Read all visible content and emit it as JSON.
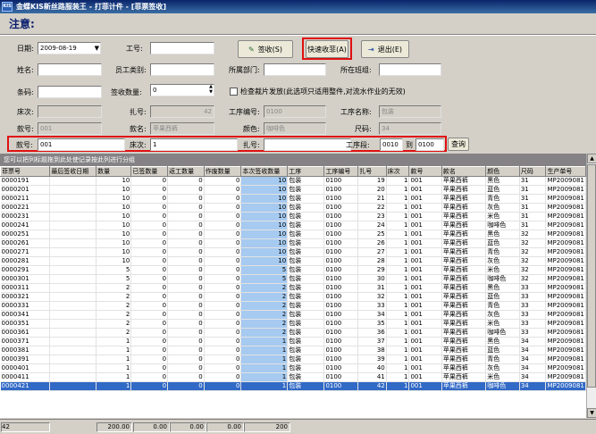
{
  "window": {
    "title": "金蝶KIS新丝路服装王 - 打菲计件 - [菲票签收]",
    "icon_text": "KIS"
  },
  "notice_title": "注意:",
  "form": {
    "date_label": "日期:",
    "date_value": "2009-08-19",
    "worker_no_label": "工号:",
    "name_label": "姓名:",
    "emp_type_label": "员工类别:",
    "dept_label": "所属部门:",
    "group_label": "所在班组:",
    "barcode_label": "条码:",
    "qty_label": "签收数量:",
    "qty_value": "0",
    "check_label": "检查裁片发放(此选项只适用整件,对流水作业的无效)",
    "bed_label": "床次:",
    "tie_label": "扎号:",
    "tie_value": "42",
    "proc_no_label": "工序编号:",
    "proc_no_value": "0100",
    "proc_name_label": "工序名称:",
    "proc_name_value": "包装",
    "style_label": "款号:",
    "style_value": "001",
    "style_name_label": "款名:",
    "style_name_value": "苹果西裤",
    "color_label": "颜色:",
    "color_value": "咖啡色",
    "size_label": "尺码:",
    "size_value": "34"
  },
  "buttons": {
    "sign": "签收(S)",
    "quick": "快速收菲(A)",
    "exit": "退出(E)",
    "query": "查询"
  },
  "filter": {
    "style_label": "款号:",
    "style_value": "001",
    "bed_label": "床次:",
    "bed_value": "1",
    "tie_label": "扎号:",
    "proc_label": "工序段:",
    "from": "0010",
    "to_label": "到",
    "to": "0100"
  },
  "group_hint": "您可以把列标题拖到此处使记录按此列进行分组",
  "table": {
    "columns": [
      "菲票号",
      "最后签收日期",
      "数量",
      "已签数量",
      "返工数量",
      "作废数量",
      "本次签收数量",
      "工序",
      "工序编号",
      "扎号",
      "床次",
      "款号",
      "款名",
      "颜色",
      "尺码",
      "生产单号"
    ],
    "rows": [
      [
        "0000191",
        "",
        "10",
        "0",
        "0",
        "0",
        "10",
        "包装",
        "0100",
        "19",
        "1",
        "001",
        "苹果西裤",
        "黑色",
        "31",
        "MP2009081"
      ],
      [
        "0000201",
        "",
        "10",
        "0",
        "0",
        "0",
        "10",
        "包装",
        "0100",
        "20",
        "1",
        "001",
        "苹果西裤",
        "蓝色",
        "31",
        "MP2009081"
      ],
      [
        "0000211",
        "",
        "10",
        "0",
        "0",
        "0",
        "10",
        "包装",
        "0100",
        "21",
        "1",
        "001",
        "苹果西裤",
        "青色",
        "31",
        "MP2009081"
      ],
      [
        "0000221",
        "",
        "10",
        "0",
        "0",
        "0",
        "10",
        "包装",
        "0100",
        "22",
        "1",
        "001",
        "苹果西裤",
        "灰色",
        "31",
        "MP2009081"
      ],
      [
        "0000231",
        "",
        "10",
        "0",
        "0",
        "0",
        "10",
        "包装",
        "0100",
        "23",
        "1",
        "001",
        "苹果西裤",
        "米色",
        "31",
        "MP2009081"
      ],
      [
        "0000241",
        "",
        "10",
        "0",
        "0",
        "0",
        "10",
        "包装",
        "0100",
        "24",
        "1",
        "001",
        "苹果西裤",
        "咖啡色",
        "31",
        "MP2009081"
      ],
      [
        "0000251",
        "",
        "10",
        "0",
        "0",
        "0",
        "10",
        "包装",
        "0100",
        "25",
        "1",
        "001",
        "苹果西裤",
        "黑色",
        "32",
        "MP2009081"
      ],
      [
        "0000261",
        "",
        "10",
        "0",
        "0",
        "0",
        "10",
        "包装",
        "0100",
        "26",
        "1",
        "001",
        "苹果西裤",
        "蓝色",
        "32",
        "MP2009081"
      ],
      [
        "0000271",
        "",
        "10",
        "0",
        "0",
        "0",
        "10",
        "包装",
        "0100",
        "27",
        "1",
        "001",
        "苹果西裤",
        "青色",
        "32",
        "MP2009081"
      ],
      [
        "0000281",
        "",
        "10",
        "0",
        "0",
        "0",
        "10",
        "包装",
        "0100",
        "28",
        "1",
        "001",
        "苹果西裤",
        "灰色",
        "32",
        "MP2009081"
      ],
      [
        "0000291",
        "",
        "5",
        "0",
        "0",
        "0",
        "5",
        "包装",
        "0100",
        "29",
        "1",
        "001",
        "苹果西裤",
        "米色",
        "32",
        "MP2009081"
      ],
      [
        "0000301",
        "",
        "5",
        "0",
        "0",
        "0",
        "5",
        "包装",
        "0100",
        "30",
        "1",
        "001",
        "苹果西裤",
        "咖啡色",
        "32",
        "MP2009081"
      ],
      [
        "0000311",
        "",
        "2",
        "0",
        "0",
        "0",
        "2",
        "包装",
        "0100",
        "31",
        "1",
        "001",
        "苹果西裤",
        "黑色",
        "33",
        "MP2009081"
      ],
      [
        "0000321",
        "",
        "2",
        "0",
        "0",
        "0",
        "2",
        "包装",
        "0100",
        "32",
        "1",
        "001",
        "苹果西裤",
        "蓝色",
        "33",
        "MP2009081"
      ],
      [
        "0000331",
        "",
        "2",
        "0",
        "0",
        "0",
        "2",
        "包装",
        "0100",
        "33",
        "1",
        "001",
        "苹果西裤",
        "青色",
        "33",
        "MP2009081"
      ],
      [
        "0000341",
        "",
        "2",
        "0",
        "0",
        "0",
        "2",
        "包装",
        "0100",
        "34",
        "1",
        "001",
        "苹果西裤",
        "灰色",
        "33",
        "MP2009081"
      ],
      [
        "0000351",
        "",
        "2",
        "0",
        "0",
        "0",
        "2",
        "包装",
        "0100",
        "35",
        "1",
        "001",
        "苹果西裤",
        "米色",
        "33",
        "MP2009081"
      ],
      [
        "0000361",
        "",
        "2",
        "0",
        "0",
        "0",
        "2",
        "包装",
        "0100",
        "36",
        "1",
        "001",
        "苹果西裤",
        "咖啡色",
        "33",
        "MP2009081"
      ],
      [
        "0000371",
        "",
        "1",
        "0",
        "0",
        "0",
        "1",
        "包装",
        "0100",
        "37",
        "1",
        "001",
        "苹果西裤",
        "黑色",
        "34",
        "MP2009081"
      ],
      [
        "0000381",
        "",
        "1",
        "0",
        "0",
        "0",
        "1",
        "包装",
        "0100",
        "38",
        "1",
        "001",
        "苹果西裤",
        "蓝色",
        "34",
        "MP2009081"
      ],
      [
        "0000391",
        "",
        "1",
        "0",
        "0",
        "0",
        "1",
        "包装",
        "0100",
        "39",
        "1",
        "001",
        "苹果西裤",
        "青色",
        "34",
        "MP2009081"
      ],
      [
        "0000401",
        "",
        "1",
        "0",
        "0",
        "0",
        "1",
        "包装",
        "0100",
        "40",
        "1",
        "001",
        "苹果西裤",
        "灰色",
        "34",
        "MP2009081"
      ],
      [
        "0000411",
        "",
        "1",
        "0",
        "0",
        "0",
        "1",
        "包装",
        "0100",
        "41",
        "1",
        "001",
        "苹果西裤",
        "米色",
        "34",
        "MP2009081"
      ],
      [
        "0000421",
        "",
        "1",
        "0",
        "0",
        "0",
        "1",
        "包装",
        "0100",
        "42",
        "1",
        "001",
        "苹果西裤",
        "咖啡色",
        "34",
        "MP2009081"
      ]
    ],
    "selected_index": 23
  },
  "footer": {
    "count": "42",
    "qty": "200.00",
    "signed": "0.00",
    "rework": "0.00",
    "void": "0.00",
    "this": "200"
  },
  "colors": {
    "highlight": "#e01010",
    "selected_row": "#3169c6",
    "current_col": "#a6caf0"
  }
}
